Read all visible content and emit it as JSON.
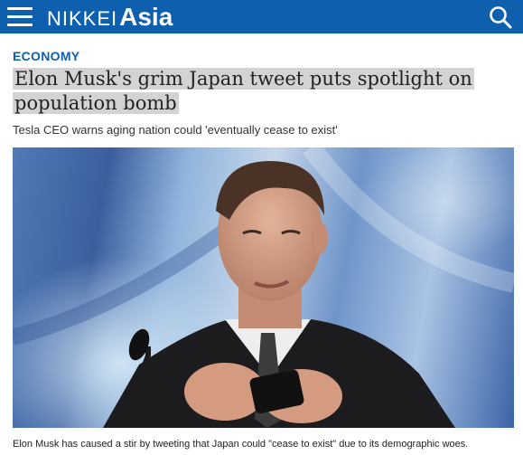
{
  "header": {
    "brand_part1": "NIKKEI",
    "brand_part2": "Asia",
    "menu_icon": "hamburger-menu-icon",
    "search_icon": "search-icon",
    "background_color": "#0e5fae"
  },
  "article": {
    "section": "ECONOMY",
    "headline": "Elon Musk's grim Japan tweet puts spotlight on population bomb",
    "subheadline": "Tesla CEO warns aging nation could 'eventually cease to exist'",
    "caption": "Elon Musk has caused a stir by tweeting that Japan could \"cease to exist\" due to its demographic woes.",
    "section_color": "#0e5fae"
  }
}
